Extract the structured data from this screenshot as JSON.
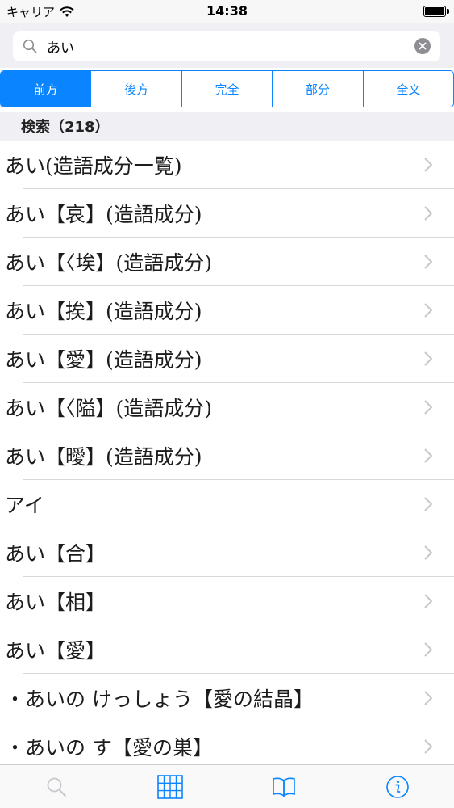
{
  "status_bar": {
    "carrier": "キャリア",
    "time": "14:38"
  },
  "search": {
    "value": "あい",
    "placeholder": ""
  },
  "segments": [
    {
      "label": "前方",
      "active": true
    },
    {
      "label": "後方",
      "active": false
    },
    {
      "label": "完全",
      "active": false
    },
    {
      "label": "部分",
      "active": false
    },
    {
      "label": "全文",
      "active": false
    }
  ],
  "section_header": "検索（218）",
  "results": [
    "あい(造語成分一覧)",
    "あい【哀】(造語成分)",
    "あい【〈埃】(造語成分)",
    "あい【挨】(造語成分)",
    "あい【愛】(造語成分)",
    "あい【〈隘】(造語成分)",
    "あい【曖】(造語成分)",
    "アイ",
    "あい【合】",
    "あい【相】",
    "あい【愛】",
    "・あいの けっしょう【愛の結晶】",
    "・あいの す【愛の巣】"
  ],
  "tab_bar": {
    "tabs": [
      "search-tab",
      "index-tab",
      "book-tab",
      "info-tab"
    ]
  },
  "colors": {
    "accent": "#0a84ff",
    "header_bg": "#efeff4",
    "separator": "#d8d8dc",
    "chevron": "#c7c7cc",
    "inactive_icon": "#c7c7cc"
  }
}
